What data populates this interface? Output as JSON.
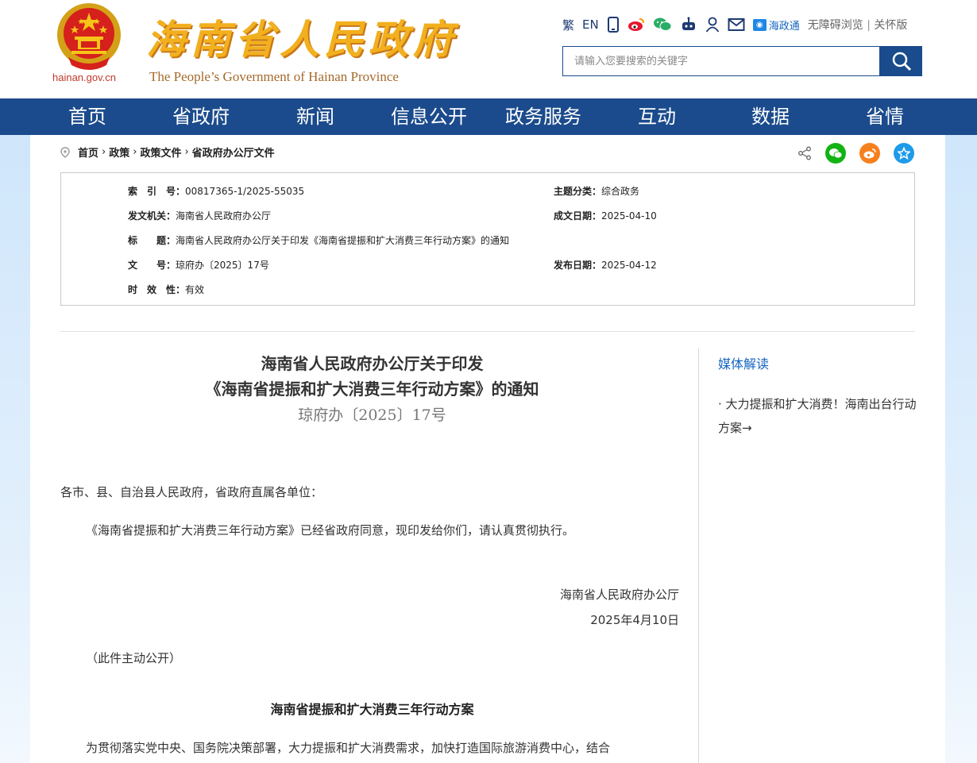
{
  "header": {
    "site_domain": "hainan.gov.cn",
    "site_title": "海南省人民政府",
    "site_subtitle": "The People’s Government  of Hainan Province",
    "tools": {
      "traditional": "繁",
      "english": "EN",
      "hainan_app": "海政通",
      "accessibility": "无障碍浏览",
      "separator": "|",
      "care_mode": "关怀版"
    },
    "search": {
      "placeholder": "请输入您要搜索的关键字",
      "value": ""
    },
    "icons": [
      "mobile-icon",
      "weibo-icon",
      "wechat-icon",
      "robot-icon",
      "user-icon",
      "mail-icon",
      "search-icon"
    ]
  },
  "nav": [
    "首页",
    "省政府",
    "新闻",
    "信息公开",
    "政务服务",
    "互动",
    "数据",
    "省情"
  ],
  "breadcrumb": [
    "首页",
    "政策",
    "政策文件",
    "省政府办公厅文件"
  ],
  "meta": {
    "index_label": "索　引　号：",
    "index_value": "00817365-1/2025-55035",
    "topic_label": "主题分类：",
    "topic_value": "综合政务",
    "issuer_label": "发文机关：",
    "issuer_value": "海南省人民政府办公厅",
    "created_label": "成文日期：",
    "created_value": "2025-04-10",
    "title_label": "标　　题：",
    "title_value": "海南省人民政府办公厅关于印发《海南省提振和扩大消费三年行动方案》的通知",
    "docno_label": "文　　号：",
    "docno_value": "琼府办〔2025〕17号",
    "published_label": "发布日期：",
    "published_value": "2025-04-12",
    "validity_label": "时　效　性：",
    "validity_value": "有效"
  },
  "document": {
    "title_line1": "海南省人民政府办公厅关于印发",
    "title_line2": "《海南省提振和扩大消费三年行动方案》的通知",
    "doc_number": "琼府办〔2025〕17号",
    "salutation": "各市、县、自治县人民政府，省政府直属各单位：",
    "paragraph1": "《海南省提振和扩大消费三年行动方案》已经省政府同意，现印发给你们，请认真贯彻执行。",
    "signature": "海南省人民政府办公厅",
    "date": "2025年4月10日",
    "public_note": "（此件主动公开）",
    "plan_title": "海南省提振和扩大消费三年行动方案",
    "plan_intro": "为贯彻落实党中央、国务院决策部署，大力提振和扩大消费需求，加快打造国际旅游消费中心，结合"
  },
  "sidebar": {
    "heading": "媒体解读",
    "link": "· 大力提振和扩大消费！海南出台行动方案→"
  },
  "colors": {
    "nav_bg": "#1b4b8c",
    "title_gold": "#f2b01e",
    "link_blue": "#1565c0",
    "wechat_green": "#12b312",
    "weibo_orange": "#f7801e",
    "collect_blue": "#1e9be8"
  }
}
